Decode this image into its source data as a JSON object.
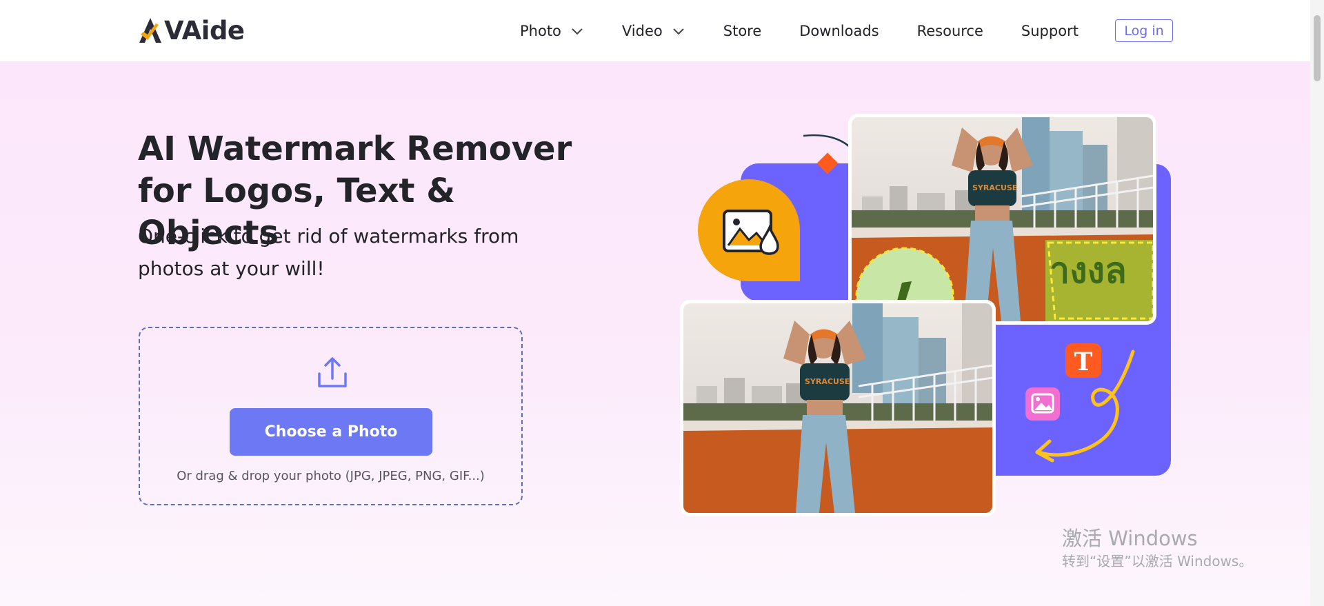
{
  "header": {
    "logo_text": "VAide",
    "nav": [
      {
        "label": "Photo",
        "has_dropdown": true
      },
      {
        "label": "Video",
        "has_dropdown": true
      },
      {
        "label": "Store",
        "has_dropdown": false
      },
      {
        "label": "Downloads",
        "has_dropdown": false
      },
      {
        "label": "Resource",
        "has_dropdown": false
      },
      {
        "label": "Support",
        "has_dropdown": false
      }
    ],
    "login_label": "Log in"
  },
  "hero": {
    "title_line1": "AI Watermark Remover",
    "title_line2": "for Logos, Text & Objects",
    "subtitle_line1": "One-click to get rid of watermarks from",
    "subtitle_line2": "photos at your will!",
    "choose_button": "Choose a Photo",
    "drop_hint": "Or drag & drop your photo (JPG, JPEG, PNG, GIF...)"
  },
  "illustration": {
    "shirt_text": "SYRACUSE",
    "badge_letter": "T",
    "wall_text": "างงล",
    "icons": [
      "image-watermark-icon",
      "text-t-icon",
      "picture-icon"
    ]
  },
  "windows_watermark": {
    "line1": "激活 Windows",
    "line2": "转到“设置”以激活 Windows。"
  },
  "colors": {
    "accent": "#6c78f4",
    "purple_panel": "#6c63ff",
    "orange": "#f5a40c",
    "hero_bg": "#fce6fb"
  }
}
